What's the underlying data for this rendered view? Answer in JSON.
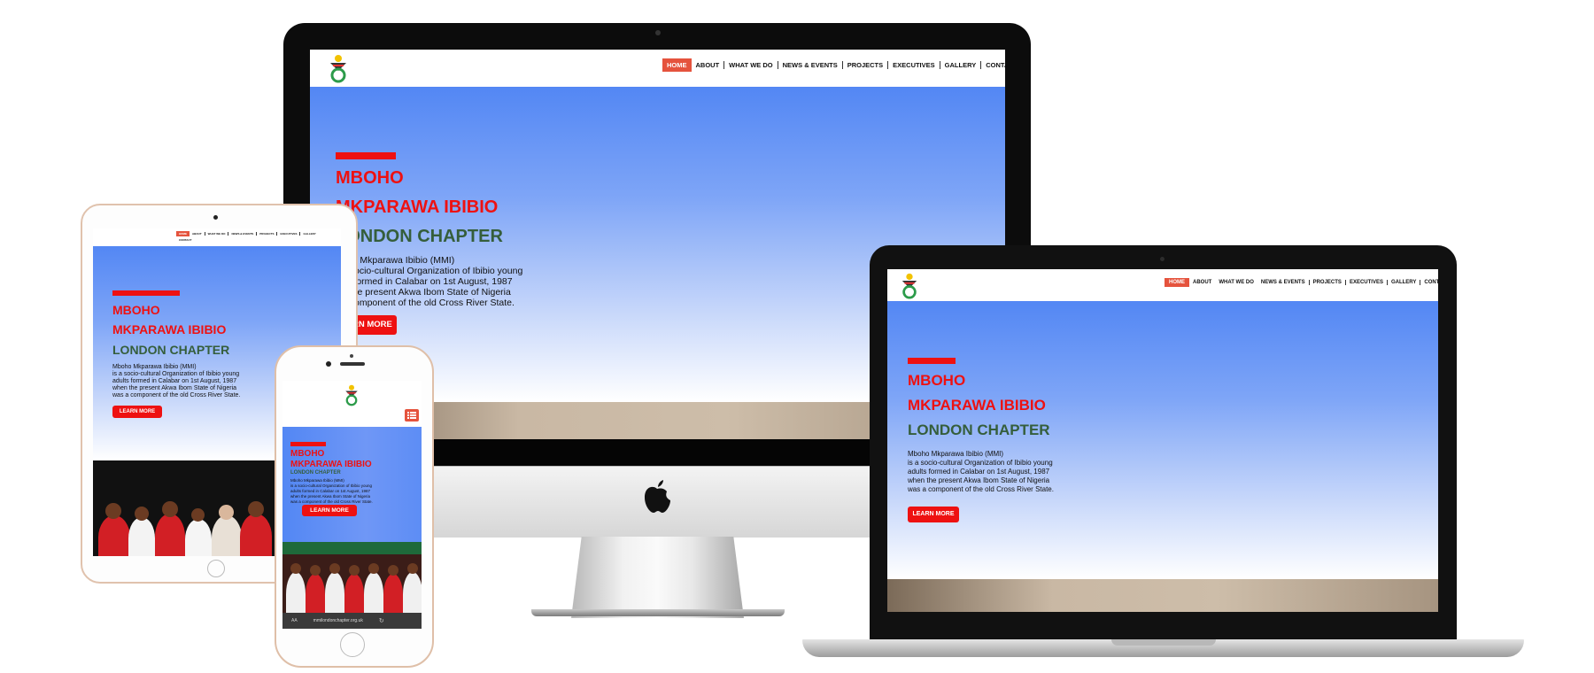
{
  "site": {
    "nav": [
      "HOME",
      "ABOUT",
      "WHAT WE DO",
      "NEWS & EVENTS",
      "PROJECTS",
      "EXECUTIVES",
      "GALLERY",
      "CONTACT"
    ],
    "hero": {
      "line1": "MBOHO",
      "line2": "MKPARAWA IBIBIO",
      "line3": "LONDON CHAPTER",
      "desc_lines": [
        "Mboho Mkparawa Ibibio (MMI)",
        "is a socio-cultural Organization of Ibibio young",
        "adults formed in Calabar on 1st August, 1987",
        "when the present Akwa Ibom State of Nigeria",
        "was a component of the old Cross River State."
      ],
      "button": "LEARN MORE"
    },
    "imac_visible": {
      "line3": "ONDON CHAPTER",
      "desc_lines": [
        "oho Mkparawa Ibibio (MMI)",
        "a socio-cultural Organization of Ibibio young",
        "lts formed in Calabar on 1st August, 1987",
        "n the present Akwa Ibom State of Nigeria",
        "a component of the old Cross River State."
      ],
      "button": "ARN MORE"
    },
    "phone_url": "mmilondonchapter.org.uk",
    "phone_aa": "AA",
    "colors": {
      "accent_red": "#ee1111",
      "nav_home": "#e5533d",
      "green": "#355e3b",
      "hero_blue": "#5387f4"
    }
  }
}
